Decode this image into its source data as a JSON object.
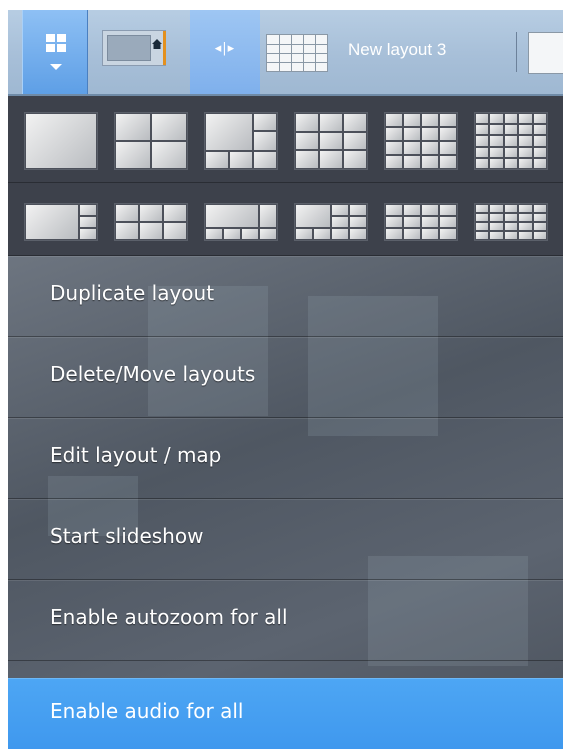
{
  "toolbar": {
    "layout_menu_icon": "layouts-grid-icon",
    "home_icon": "home-icon",
    "splitter_label": "◂|▸",
    "active_layout_name": "New layout 3"
  },
  "layout_templates": {
    "row1": [
      "1x1",
      "2x2",
      "1+5",
      "3x3",
      "4x4",
      "5x5"
    ],
    "row2": [
      "1+2 wide",
      "3x2 wide",
      "1+4 wide",
      "1+8 wide",
      "4x3 wide",
      "5x4 wide"
    ]
  },
  "menu": {
    "items": [
      {
        "label": "Duplicate layout"
      },
      {
        "label": "Delete/Move layouts"
      },
      {
        "label": "Edit layout / map"
      },
      {
        "label": "Start slideshow"
      },
      {
        "label": "Enable autozoom for all"
      },
      {
        "label": "Enable audio for all"
      }
    ]
  },
  "colors": {
    "highlight": "#4da6f4",
    "panel": "#3a3e48",
    "toolbar": "#a7bfd8"
  }
}
